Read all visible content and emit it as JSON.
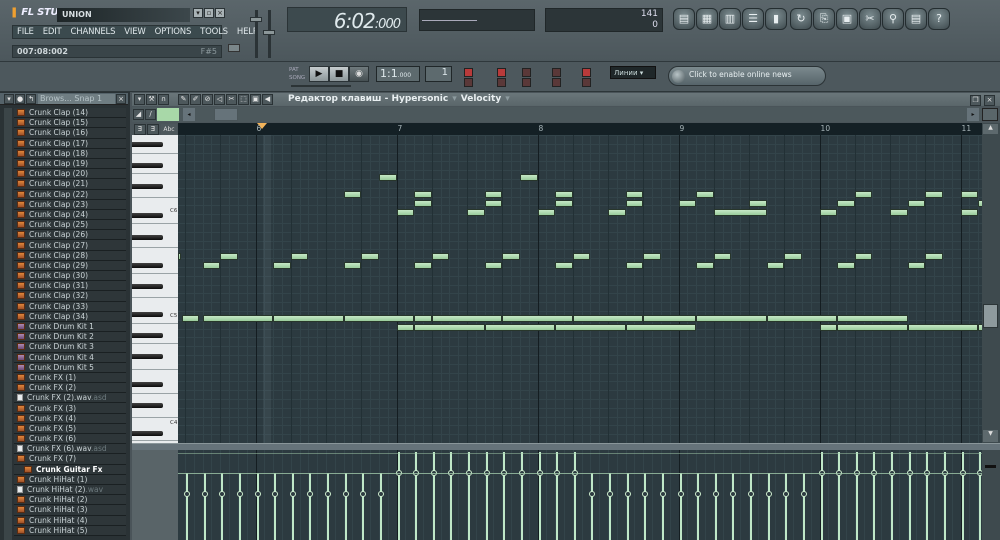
{
  "app": {
    "logo": "FL STUDIO",
    "song_title": "UNION",
    "window_buttons": [
      "minimize",
      "restore",
      "close"
    ]
  },
  "menu": [
    "FILE",
    "EDIT",
    "CHANNELS",
    "VIEW",
    "OPTIONS",
    "TOOLS",
    "HELP"
  ],
  "hint_bar": {
    "text": "007:08:002",
    "right": "F#5"
  },
  "time_display": {
    "main": "6:02",
    "ticks": ":000"
  },
  "cpu_panel": {
    "value": "141",
    "poly": "0"
  },
  "toolbar_icons": [
    "playlist-icon",
    "step-sequencer-icon",
    "piano-roll-icon",
    "browser-icon",
    "mixer-icon",
    "undo-icon",
    "save-icon",
    "render-icon",
    "cut-icon",
    "search-icon",
    "project-info-icon",
    "help-icon"
  ],
  "transport": {
    "tempo_display": "1:1",
    "tempo_small": ".000",
    "pattern_display": "1",
    "mode_pat": "PAT",
    "mode_song": "SONG",
    "snap_select": "Линии"
  },
  "news": {
    "text": "Click to enable online news"
  },
  "browser": {
    "title": "Brows... Snap 1",
    "items": [
      {
        "label": "Crunk Clap (14)",
        "type": "file"
      },
      {
        "label": "Crunk Clap (15)",
        "type": "file"
      },
      {
        "label": "Crunk Clap (16)",
        "type": "file"
      },
      {
        "label": "Crunk Clap (17)",
        "type": "file"
      },
      {
        "label": "Crunk Clap (18)",
        "type": "file"
      },
      {
        "label": "Crunk Clap (19)",
        "type": "file"
      },
      {
        "label": "Crunk Clap (20)",
        "type": "file"
      },
      {
        "label": "Crunk Clap (21)",
        "type": "file"
      },
      {
        "label": "Crunk Clap (22)",
        "type": "file"
      },
      {
        "label": "Crunk Clap (23)",
        "type": "file"
      },
      {
        "label": "Crunk Clap (24)",
        "type": "file"
      },
      {
        "label": "Crunk Clap (25)",
        "type": "file"
      },
      {
        "label": "Crunk Clap (26)",
        "type": "file"
      },
      {
        "label": "Crunk Clap (27)",
        "type": "file"
      },
      {
        "label": "Crunk Clap (28)",
        "type": "file"
      },
      {
        "label": "Crunk Clap (29)",
        "type": "file"
      },
      {
        "label": "Crunk Clap (30)",
        "type": "file"
      },
      {
        "label": "Crunk Clap (31)",
        "type": "file"
      },
      {
        "label": "Crunk Clap (32)",
        "type": "file"
      },
      {
        "label": "Crunk Clap (33)",
        "type": "file"
      },
      {
        "label": "Crunk Clap (34)",
        "type": "file"
      },
      {
        "label": "Crunk Drum Kit 1",
        "type": "kit"
      },
      {
        "label": "Crunk Drum Kit 2",
        "type": "kit"
      },
      {
        "label": "Crunk Drum Kit 3",
        "type": "kit"
      },
      {
        "label": "Crunk Drum Kit 4",
        "type": "kit"
      },
      {
        "label": "Crunk Drum Kit 5",
        "type": "kit"
      },
      {
        "label": "Crunk FX (1)",
        "type": "file"
      },
      {
        "label": "Crunk FX (2)",
        "type": "file"
      },
      {
        "label": "Crunk FX (2).wav",
        "ext": ".asd",
        "type": "wav"
      },
      {
        "label": "Crunk FX (3)",
        "type": "file"
      },
      {
        "label": "Crunk FX (4)",
        "type": "file"
      },
      {
        "label": "Crunk FX (5)",
        "type": "file"
      },
      {
        "label": "Crunk FX (6)",
        "type": "file"
      },
      {
        "label": "Crunk FX (6).wav",
        "ext": ".asd",
        "type": "wav"
      },
      {
        "label": "Crunk FX (7)",
        "type": "file"
      },
      {
        "label": "Crunk Guitar Fx",
        "type": "folder"
      },
      {
        "label": "Crunk HiHat (1)",
        "type": "file"
      },
      {
        "label": "Crunk HiHat (2)",
        "ext": ".wav",
        "type": "wav"
      },
      {
        "label": "Crunk HiHat (2)",
        "type": "file"
      },
      {
        "label": "Crunk HiHat (3)",
        "type": "file"
      },
      {
        "label": "Crunk HiHat (4)",
        "type": "file"
      },
      {
        "label": "Crunk HiHat (5)",
        "type": "file"
      }
    ]
  },
  "piano_roll": {
    "title": "Редактор клавиш - Hypersonic",
    "target": "Velocity",
    "ruler_bars": [
      "6",
      "7",
      "8",
      "9",
      "10",
      "11"
    ],
    "key_labels": [
      "C6",
      "C5",
      "C4"
    ],
    "view_start_bar": 5.45,
    "steps_per_bar": 16,
    "note_color": "#b2dcb4",
    "notes": [
      {
        "row": 0,
        "start": 6.875,
        "len": 0.125
      },
      {
        "row": 0,
        "start": 7.875,
        "len": 0.125
      },
      {
        "row": 1,
        "start": 6.625,
        "len": 0.125
      },
      {
        "row": 1,
        "start": 7.125,
        "len": 0.125
      },
      {
        "row": 1,
        "start": 7.625,
        "len": 0.125
      },
      {
        "row": 1,
        "start": 8.125,
        "len": 0.125
      },
      {
        "row": 1,
        "start": 8.625,
        "len": 0.125
      },
      {
        "row": 1,
        "start": 9.125,
        "len": 0.125
      },
      {
        "row": 1,
        "start": 10.25,
        "len": 0.125
      },
      {
        "row": 1,
        "start": 10.75,
        "len": 0.125
      },
      {
        "row": 1,
        "start": 11.0,
        "len": 0.125
      },
      {
        "row": 2,
        "start": 7.125,
        "len": 0.125
      },
      {
        "row": 2,
        "start": 7.625,
        "len": 0.125
      },
      {
        "row": 2,
        "start": 8.125,
        "len": 0.125
      },
      {
        "row": 2,
        "start": 8.625,
        "len": 0.125
      },
      {
        "row": 2,
        "start": 9.0,
        "len": 0.125
      },
      {
        "row": 2,
        "start": 9.5,
        "len": 0.125
      },
      {
        "row": 2,
        "start": 10.125,
        "len": 0.125
      },
      {
        "row": 2,
        "start": 10.625,
        "len": 0.125
      },
      {
        "row": 2,
        "start": 11.125,
        "len": 0.125
      },
      {
        "row": 3,
        "start": 7.0,
        "len": 0.125
      },
      {
        "row": 3,
        "start": 7.5,
        "len": 0.125
      },
      {
        "row": 3,
        "start": 8.0,
        "len": 0.125
      },
      {
        "row": 3,
        "start": 8.5,
        "len": 0.125
      },
      {
        "row": 3,
        "start": 9.25,
        "len": 0.375
      },
      {
        "row": 3,
        "start": 10.0,
        "len": 0.125
      },
      {
        "row": 3,
        "start": 10.5,
        "len": 0.125
      },
      {
        "row": 3,
        "start": 11.0,
        "len": 0.125
      },
      {
        "row": 4,
        "start": 5.45,
        "len": 0.02
      },
      {
        "row": 4,
        "start": 5.75,
        "len": 0.125
      },
      {
        "row": 4,
        "start": 6.25,
        "len": 0.125
      },
      {
        "row": 4,
        "start": 6.75,
        "len": 0.125
      },
      {
        "row": 4,
        "start": 7.25,
        "len": 0.125
      },
      {
        "row": 4,
        "start": 7.75,
        "len": 0.125
      },
      {
        "row": 4,
        "start": 8.25,
        "len": 0.125
      },
      {
        "row": 4,
        "start": 8.75,
        "len": 0.125
      },
      {
        "row": 4,
        "start": 9.25,
        "len": 0.125
      },
      {
        "row": 4,
        "start": 9.75,
        "len": 0.125
      },
      {
        "row": 4,
        "start": 10.25,
        "len": 0.125
      },
      {
        "row": 4,
        "start": 10.75,
        "len": 0.125
      },
      {
        "row": 5,
        "start": 5.625,
        "len": 0.125
      },
      {
        "row": 5,
        "start": 6.125,
        "len": 0.125
      },
      {
        "row": 5,
        "start": 6.625,
        "len": 0.125
      },
      {
        "row": 5,
        "start": 7.125,
        "len": 0.125
      },
      {
        "row": 5,
        "start": 7.625,
        "len": 0.125
      },
      {
        "row": 5,
        "start": 8.125,
        "len": 0.125
      },
      {
        "row": 5,
        "start": 8.625,
        "len": 0.125
      },
      {
        "row": 5,
        "start": 9.125,
        "len": 0.125
      },
      {
        "row": 5,
        "start": 9.625,
        "len": 0.125
      },
      {
        "row": 5,
        "start": 10.125,
        "len": 0.125
      },
      {
        "row": 5,
        "start": 10.625,
        "len": 0.125
      },
      {
        "row": 6,
        "start": 5.475,
        "len": 0.125
      },
      {
        "row": 6,
        "start": 5.625,
        "len": 0.5
      },
      {
        "row": 6,
        "start": 6.125,
        "len": 0.5
      },
      {
        "row": 6,
        "start": 6.625,
        "len": 0.5
      },
      {
        "row": 6,
        "start": 7.125,
        "len": 0.125
      },
      {
        "row": 6,
        "start": 7.25,
        "len": 0.5
      },
      {
        "row": 6,
        "start": 7.75,
        "len": 0.5
      },
      {
        "row": 6,
        "start": 8.25,
        "len": 0.5
      },
      {
        "row": 6,
        "start": 8.75,
        "len": 0.375
      },
      {
        "row": 6,
        "start": 9.125,
        "len": 0.5
      },
      {
        "row": 6,
        "start": 9.625,
        "len": 0.5
      },
      {
        "row": 6,
        "start": 10.125,
        "len": 0.5
      },
      {
        "row": 7,
        "start": 7.0,
        "len": 0.125
      },
      {
        "row": 7,
        "start": 7.125,
        "len": 0.5
      },
      {
        "row": 7,
        "start": 7.625,
        "len": 0.5
      },
      {
        "row": 7,
        "start": 8.125,
        "len": 0.5
      },
      {
        "row": 7,
        "start": 8.625,
        "len": 0.5
      },
      {
        "row": 7,
        "start": 10.0,
        "len": 0.125
      },
      {
        "row": 7,
        "start": 10.125,
        "len": 0.5
      },
      {
        "row": 7,
        "start": 10.625,
        "len": 0.5
      },
      {
        "row": 7,
        "start": 11.125,
        "len": 0.5
      }
    ],
    "velocity": {
      "steps_start": 5.45,
      "high_ranges": [
        [
          7.0,
          8.375
        ],
        [
          10.0,
          11.25
        ]
      ]
    }
  }
}
